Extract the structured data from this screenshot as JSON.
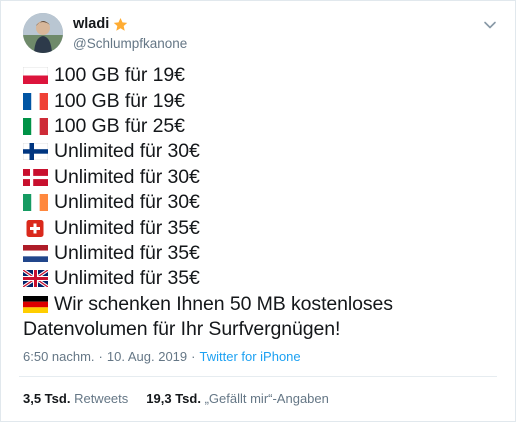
{
  "user": {
    "display_name": "wladi",
    "handle": "@Schlumpfkanone"
  },
  "icons": {
    "badge": "star-icon",
    "menu": "chevron-down-icon"
  },
  "tweet": {
    "lines": [
      {
        "flag": "poland-flag-icon",
        "text": "100 GB für 19€"
      },
      {
        "flag": "france-flag-icon",
        "text": "100 GB für 19€"
      },
      {
        "flag": "italy-flag-icon",
        "text": "100 GB für 25€"
      },
      {
        "flag": "finland-flag-icon",
        "text": "Unlimited für 30€"
      },
      {
        "flag": "denmark-flag-icon",
        "text": "Unlimited für 30€"
      },
      {
        "flag": "ireland-flag-icon",
        "text": "Unlimited für 30€"
      },
      {
        "flag": "switzerland-flag-icon",
        "text": "Unlimited für 35€"
      },
      {
        "flag": "netherlands-flag-icon",
        "text": "Unlimited für 35€"
      },
      {
        "flag": "uk-flag-icon",
        "text": "Unlimited für 35€"
      },
      {
        "flag": "germany-flag-icon",
        "text": "Wir schenken Ihnen 50 MB kostenloses"
      },
      {
        "flag": "",
        "text": "Datenvolumen für Ihr Surfvergnügen!"
      }
    ]
  },
  "meta": {
    "time": "6:50 nachm.",
    "separator": "·",
    "date": "10. Aug. 2019",
    "source": "Twitter for iPhone"
  },
  "stats": {
    "retweets_count": "3,5 Tsd.",
    "retweets_label": "Retweets",
    "likes_count": "19,3 Tsd.",
    "likes_label": "„Gefällt mir“-Angaben"
  },
  "colors": {
    "text": "#14171a",
    "secondary": "#657786",
    "link": "#1da1f2",
    "star": "#ffac33",
    "border": "#e1e8ed"
  }
}
